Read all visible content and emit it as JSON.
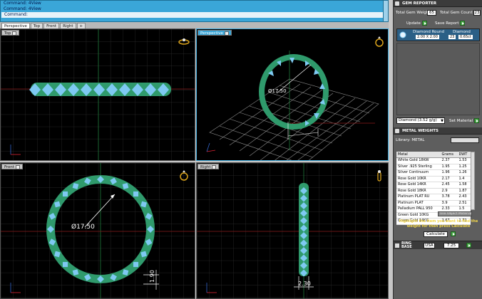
{
  "command": {
    "lines": [
      "Command: 4View",
      "Command: 4View"
    ],
    "prompt": "Command:"
  },
  "tabs": [
    "Perspective",
    "Top",
    "Front",
    "Right",
    "+"
  ],
  "viewports": {
    "top": {
      "label": "Top"
    },
    "perspective": {
      "label": "Perspective",
      "dim": "Ø17.50"
    },
    "front": {
      "label": "Front",
      "dim_diameter": "Ø17.50",
      "dim_height": "1.90"
    },
    "right": {
      "label": "Right",
      "dim_width": "2.30"
    }
  },
  "gem_reporter": {
    "title": "GEM REPORTER",
    "total_weight_label": "Total Gem Weight",
    "total_weight_value": "65",
    "total_count_label": "Total Gem Count",
    "total_count_value": "23",
    "update_label": "Update",
    "save_label": "Save Report",
    "gem": {
      "name": "Diamond Round",
      "size": "2.00 X 2.00",
      "type": "Diamond",
      "count": "23",
      "weight": "0.65ct"
    },
    "material_select": "Diamond",
    "material_density": "(3.52 g/g)",
    "set_material_label": "Set Material"
  },
  "metal_weights": {
    "title": "METAL WEIGHTS",
    "library_label": "Library: METAL",
    "columns": [
      "Metal",
      "Grams",
      "DWT"
    ],
    "rows": [
      [
        "White Gold 18KW",
        "2.37",
        "1.53"
      ],
      [
        "Silver .925 Sterling",
        "1.95",
        "1.25"
      ],
      [
        "Silver Continuum",
        "1.96",
        "1.26"
      ],
      [
        "Rose Gold 10KR",
        "2.17",
        "1.4"
      ],
      [
        "Rose Gold 14KR",
        "2.45",
        "1.58"
      ],
      [
        "Rose Gold 18KR",
        "2.9",
        "1.87"
      ],
      [
        "Platinum PLAT RU",
        "3.78",
        "2.43"
      ],
      [
        "Platinum PLAT",
        "3.9",
        "2.51"
      ],
      [
        "Palladium PALL 950",
        "2.33",
        "1.5"
      ],
      [
        "Green Gold 10KG",
        "2.67",
        "1.72"
      ],
      [
        "Green Gold 14KG",
        "2.67",
        "1.72"
      ]
    ],
    "object_materials_label": "Use Object Materials",
    "hint": "Highlight the item you want to find the weight for then press Calculate",
    "calculate_label": "Calculate"
  },
  "ring_size": {
    "title": "RING BASE",
    "standard": "USA",
    "size": "7.25"
  },
  "colors": {
    "accent": "#3aa6d8",
    "ring": "#2f9a6c",
    "gem": "#7ec9f2",
    "grid": "#2f2f2f"
  }
}
